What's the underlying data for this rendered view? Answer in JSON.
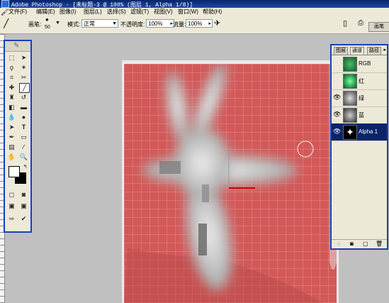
{
  "window": {
    "title": "Adobe Photoshop - [未标题-3 @ 100% (图层 1, Alpha 1/8)]"
  },
  "menu": [
    "文件(F)",
    "编辑(E)",
    "图像(I)",
    "图层(L)",
    "选择(S)",
    "滤镜(T)",
    "视图(V)",
    "窗口(W)",
    "帮助(H)"
  ],
  "options": {
    "brush_label": "画笔:",
    "brush_size": "50",
    "mode_label": "模式:",
    "mode_value": "正常",
    "opacity_label": "不透明度:",
    "opacity_value": "100%",
    "flow_label": "流量:",
    "flow_value": "100%",
    "palette_well_label": "画笔"
  },
  "channels": {
    "tabs": [
      "图层",
      "通道",
      "路径"
    ],
    "active_tab": "通道",
    "rows": [
      {
        "label": "RGB",
        "visible": false,
        "selected": false
      },
      {
        "label": "红",
        "visible": false,
        "selected": false
      },
      {
        "label": "绿",
        "visible": true,
        "selected": false
      },
      {
        "label": "蓝",
        "visible": true,
        "selected": false
      },
      {
        "label": "Alpha 1",
        "visible": true,
        "selected": true
      }
    ]
  },
  "colors": {
    "canvas_red": "#d45858",
    "selection": "#0a246a"
  }
}
